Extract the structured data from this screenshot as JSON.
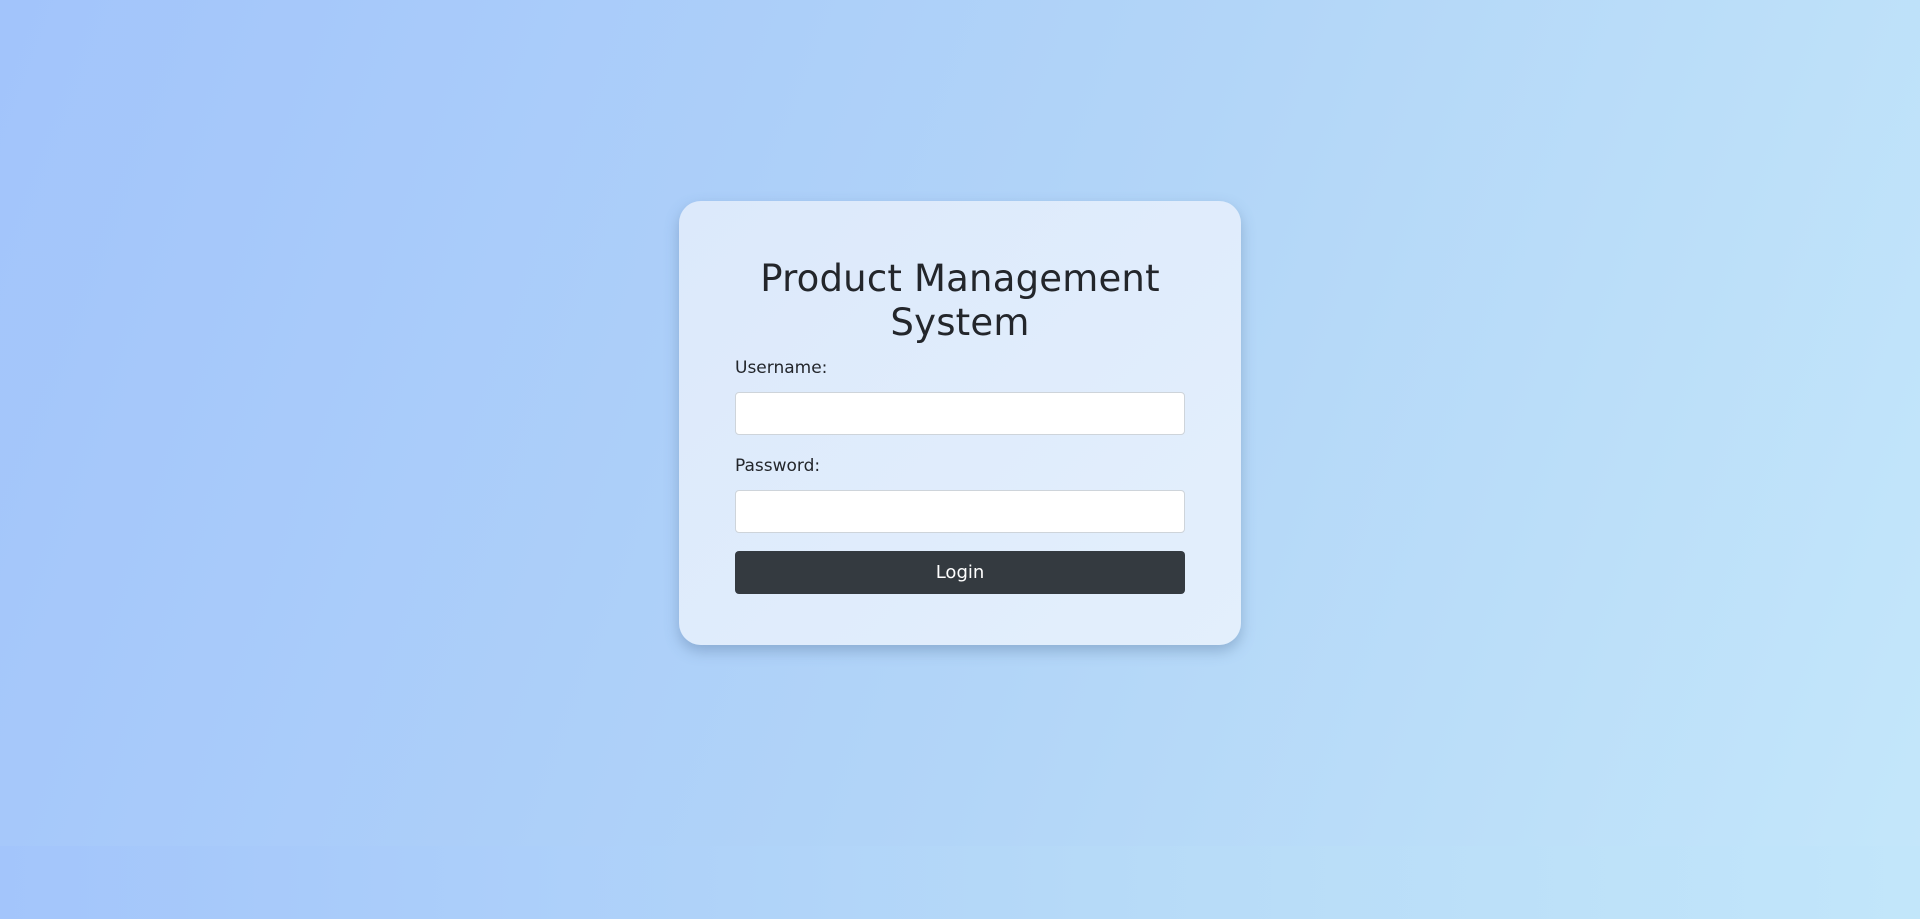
{
  "login": {
    "title": "Product Management System",
    "username_label": "Username:",
    "username_value": "",
    "password_label": "Password:",
    "password_value": "",
    "login_button_label": "Login"
  },
  "colors": {
    "background_start": "#a2c4fb",
    "background_end": "#c4e7fa",
    "card_background": "#e0ecfc",
    "button_background": "#343a40",
    "button_text": "#ffffff",
    "text": "#23262b"
  }
}
